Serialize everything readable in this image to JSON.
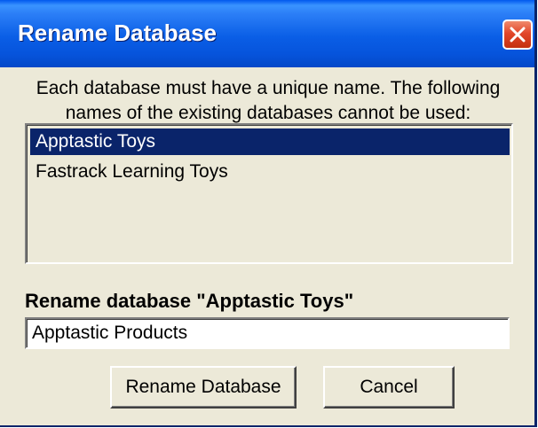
{
  "window": {
    "title": "Rename Database"
  },
  "message": {
    "line1": "Each database must have a unique name. The following",
    "line2": "names of the existing databases cannot be used:"
  },
  "existing_databases": [
    {
      "label": "Apptastic Toys",
      "selected": true
    },
    {
      "label": "Fastrack Learning Toys",
      "selected": false
    }
  ],
  "rename": {
    "label": "Rename database \"Apptastic Toys\"",
    "value": "Apptastic Products"
  },
  "buttons": {
    "rename_label": "Rename Database",
    "cancel_label": "Cancel"
  },
  "icons": {
    "close": "close-icon"
  },
  "colors": {
    "title_bar": "#0a5ee6",
    "selection": "#0a246a",
    "close_button": "#e2462a",
    "dialog_background": "#ece9d8"
  }
}
